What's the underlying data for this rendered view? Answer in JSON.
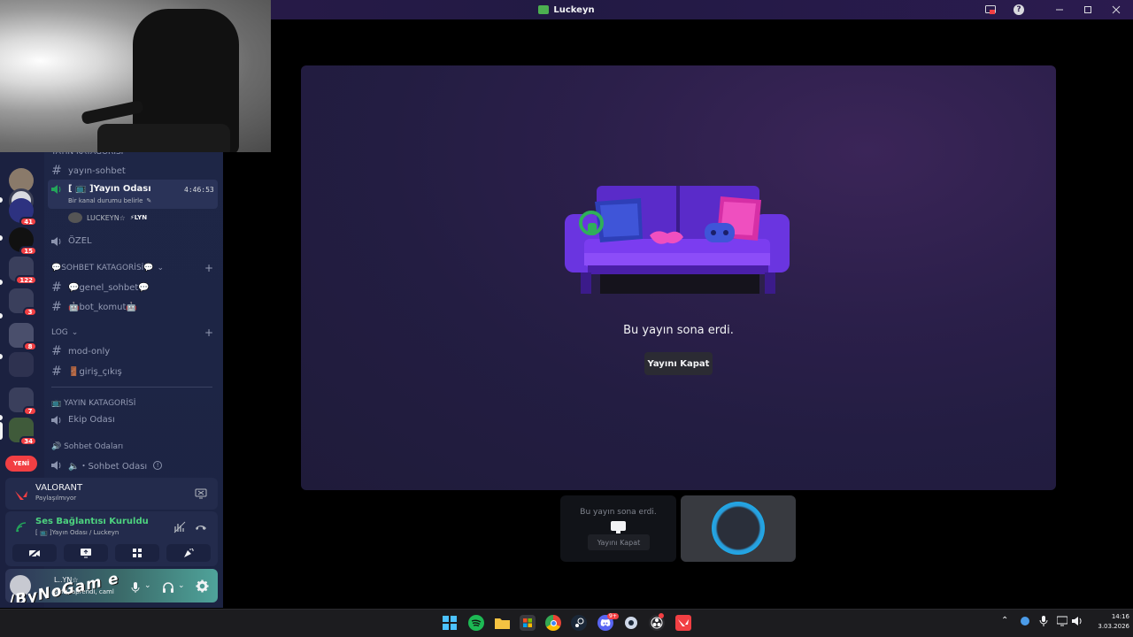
{
  "window": {
    "title": "Luckeyn"
  },
  "server_badges": [
    "41",
    "15",
    "122",
    "3",
    "8",
    "7",
    "34"
  ],
  "yeni_label": "YENİ",
  "channels": {
    "category_top": "YAYIN KATAGORİSİ",
    "yayin_sohbet": "yayın-sohbet",
    "voice_active": {
      "name": "[ 📺 ]Yayın Odası",
      "status": "Bir kanal durumu belirle",
      "timer": "4:46:53",
      "member_name": "LUCKEYN☆",
      "member_tag": "⚡LYN"
    },
    "ozel": "ÖZEL",
    "sohbet_category": "💬SOHBET KATAGORİSİ💬",
    "genel_sohbet": "💬genel_sohbet💬",
    "bot_komut": "🤖bot_komut🤖",
    "log_category": "LOG",
    "mod_only": "mod-only",
    "giris_cikis": "🚪giriş_çıkış",
    "yayin_category2": "📺 YAYIN KATAGORİSİ",
    "ekip_odasi": "Ekip Odası",
    "sohbet_odalari_category": "🔊 Sohbet Odaları",
    "sohbet_odasi": "🔈・Sohbet Odası"
  },
  "activity": {
    "game": "VALORANT",
    "status": "Paylaşılmıyor"
  },
  "voice_connection": {
    "title": "Ses Bağlantısı Kuruldu",
    "subtitle": "[ 📺 ]Yayın Odası / Luckeyn"
  },
  "user": {
    "name": "L..YN☆",
    "status": "sufri, aprendi, caml",
    "overlay_text": "/ByNoGam e"
  },
  "stream": {
    "ended_text": "Bu yayın sona erdi.",
    "close_button": "Yayını Kapat"
  },
  "tile": {
    "ended_text": "Bu yayın sona erdi.",
    "close_button": "Yayını Kapat"
  },
  "taskbar": {
    "time": "14:16",
    "date": "3.03.2026",
    "discord_badge": "9+"
  },
  "colors": {
    "accent": "#5865f2",
    "sofa": "#6a2bd8",
    "green": "#23a55a",
    "red": "#f23f43"
  }
}
